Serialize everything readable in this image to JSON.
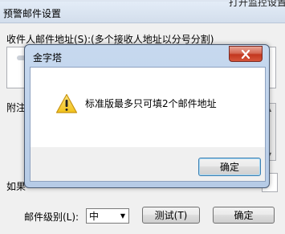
{
  "background_window": {
    "title": "预警邮件设置",
    "top_right_fragment": "打开监控设置",
    "recipients_label": "收件人邮件地址(S):(多个接收人地址以分号分割)",
    "note_label": "附注",
    "if_label": "如果",
    "level_label": "邮件级别(L):",
    "level_value": "中",
    "test_button": "测试(T)",
    "ok_button": "确定"
  },
  "dialog": {
    "title": "金字塔",
    "message": "标准版最多只可填2个邮件地址",
    "ok_button": "确定",
    "icon": "warning-icon"
  },
  "colors": {
    "warning_yellow": "#f2c21a",
    "close_red": "#c2371f",
    "dialog_frame": "#b6cbe6"
  }
}
